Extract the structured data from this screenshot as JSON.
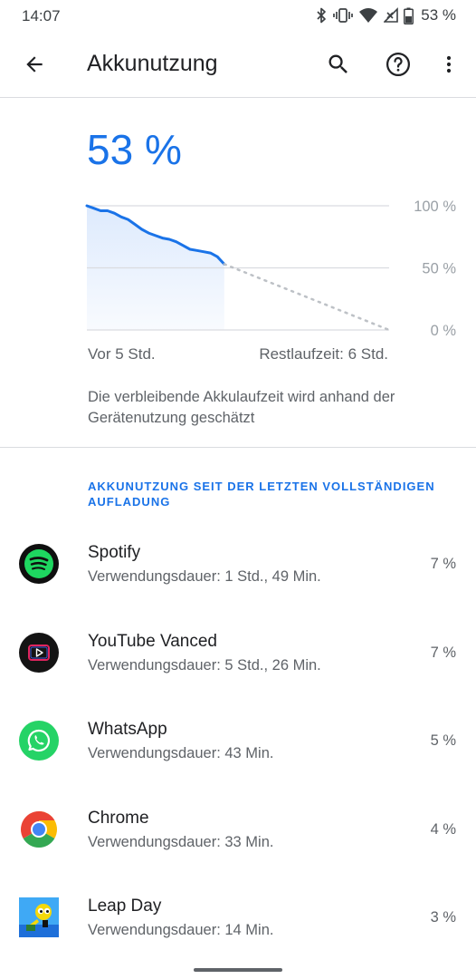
{
  "status_bar": {
    "time": "14:07",
    "battery_percent": "53 %",
    "icons": [
      "bluetooth-icon",
      "vibrate-icon",
      "wifi-icon",
      "no-signal-icon",
      "battery-icon"
    ]
  },
  "app_bar": {
    "title": "Akkunutzung",
    "icons": [
      "back-arrow-icon",
      "search-icon",
      "help-icon",
      "more-vert-icon"
    ]
  },
  "battery": {
    "level": "53 %"
  },
  "chart_data": {
    "type": "line",
    "title": "",
    "y_tick_labels": [
      "100 %",
      "50 %",
      "0 %"
    ],
    "ylim": [
      0,
      100
    ],
    "x_start_label": "Vor 5 Std.",
    "x_end_label": "Restlaufzeit: 6 Std.",
    "grid": true,
    "series": [
      {
        "kind": "history",
        "x": [
          0,
          0.25,
          0.5,
          0.75,
          1,
          1.25,
          1.5,
          1.75,
          2,
          2.25,
          2.5,
          2.75,
          3,
          3.25,
          3.5,
          3.75,
          4,
          4.25,
          4.5,
          4.75,
          5
        ],
        "y": [
          100,
          98,
          96,
          96,
          94,
          91,
          89,
          85,
          81,
          78,
          76,
          74,
          73,
          71,
          68,
          65,
          64,
          63,
          62,
          59,
          53
        ]
      },
      {
        "kind": "projection",
        "x": [
          5,
          11
        ],
        "y": [
          53,
          0
        ]
      }
    ],
    "colors": {
      "line": "#1a73e8",
      "fill": "#d2e3fc",
      "projection": "#bdc1c6",
      "grid": "#dadce0"
    }
  },
  "estimate_note": "Die verbleibende Akkulaufzeit wird anhand der Gerätenutzung geschätzt",
  "section_header": "Akkunutzung seit der letzten vollständigen Aufladung",
  "apps": [
    {
      "name": "Spotify",
      "usage": "Verwendungsdauer: 1 Std., 49 Min.",
      "percent": "7 %",
      "icon": "spotify-icon"
    },
    {
      "name": "YouTube Vanced",
      "usage": "Verwendungsdauer: 5 Std., 26 Min.",
      "percent": "7 %",
      "icon": "youtube-vanced-icon"
    },
    {
      "name": "WhatsApp",
      "usage": "Verwendungsdauer: 43 Min.",
      "percent": "5 %",
      "icon": "whatsapp-icon"
    },
    {
      "name": "Chrome",
      "usage": "Verwendungsdauer: 33 Min.",
      "percent": "4 %",
      "icon": "chrome-icon"
    },
    {
      "name": "Leap Day",
      "usage": "Verwendungsdauer: 14 Min.",
      "percent": "3 %",
      "icon": "leap-day-icon"
    }
  ],
  "colors": {
    "accent": "#1a73e8",
    "text_primary": "#202124",
    "text_secondary": "#5f6368"
  }
}
